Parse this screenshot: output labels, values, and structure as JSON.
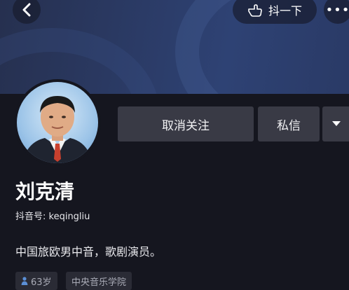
{
  "header": {
    "doushou_label": "抖一下",
    "icons": {
      "back": "chevron-left-icon",
      "doushou": "hand-pointing-icon",
      "more": "more-dots-icon"
    }
  },
  "profile": {
    "unfollow_label": "取消关注",
    "message_label": "私信",
    "name": "刘克清",
    "douyin_id": "抖音号: keqingliu",
    "bio": "中国旅欧男中音，歌剧演员。",
    "tags": {
      "age": "63岁",
      "school": "中央音乐学院"
    }
  },
  "colors": {
    "background": "#15161f",
    "button_bg": "#393a45",
    "banner": "#2b3b66"
  }
}
